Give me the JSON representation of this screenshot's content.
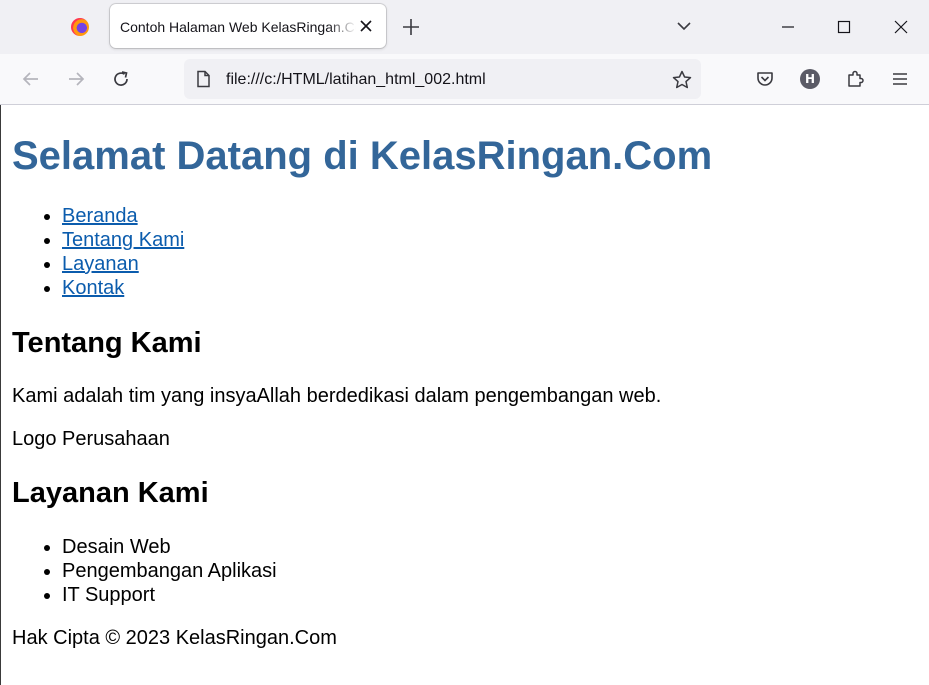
{
  "browser": {
    "tab_title": "Contoh Halaman Web KelasRingan.Com",
    "url": "file:///c:/HTML/latihan_html_002.html",
    "account_initial": "H",
    "icons": [
      "firefox-icon",
      "close-icon",
      "plus-icon",
      "chevron-down-icon",
      "minimize-icon",
      "maximize-icon",
      "close-window-icon",
      "back-icon",
      "forward-icon",
      "reload-icon",
      "page-icon",
      "star-icon",
      "pocket-icon",
      "account-icon",
      "extensions-icon",
      "menu-icon"
    ]
  },
  "page": {
    "heading": "Selamat Datang di KelasRingan.Com",
    "nav": [
      {
        "label": "Beranda"
      },
      {
        "label": "Tentang Kami"
      },
      {
        "label": "Layanan"
      },
      {
        "label": "Kontak"
      }
    ],
    "about": {
      "title": "Tentang Kami",
      "text": "Kami adalah tim yang insyaAllah berdedikasi dalam pengembangan web.",
      "logo_alt": "Logo Perusahaan"
    },
    "services": {
      "title": "Layanan Kami",
      "items": [
        "Desain Web",
        "Pengembangan Aplikasi",
        "IT Support"
      ]
    },
    "footer": "Hak Cipta © 2023 KelasRingan.Com"
  },
  "colors": {
    "heading": "#336699",
    "link": "#0b5cad",
    "tab_strip": "#f0f0f4",
    "toolbar": "#f9f9fb"
  }
}
